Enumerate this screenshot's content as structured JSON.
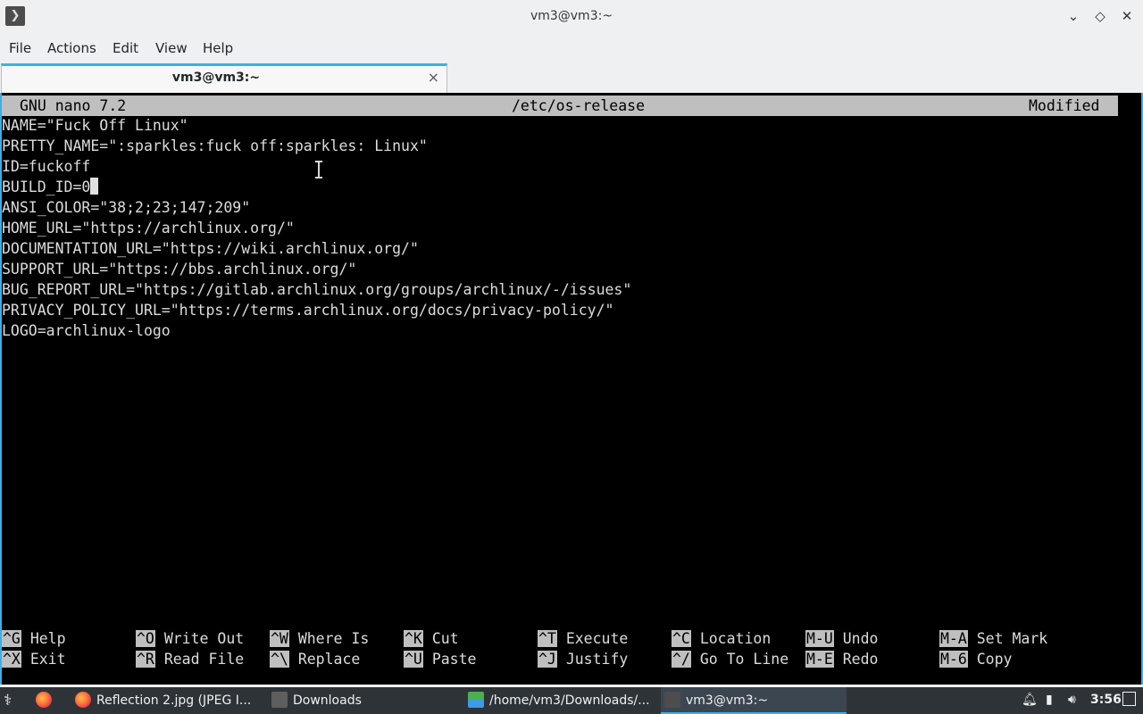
{
  "window": {
    "title": "vm3@vm3:~"
  },
  "menu": [
    "File",
    "Actions",
    "Edit",
    "View",
    "Help"
  ],
  "tab": {
    "label": "vm3@vm3:~",
    "close": "×"
  },
  "nano": {
    "version": "GNU nano 7.2",
    "filename": "/etc/os-release",
    "status": "Modified",
    "lines": [
      "NAME=\"Fuck Off Linux\"",
      "PRETTY_NAME=\":sparkles:fuck off:sparkles: Linux\"",
      "ID=fuckoff",
      "BUILD_ID=0",
      "ANSI_COLOR=\"38;2;23;147;209\"",
      "HOME_URL=\"https://archlinux.org/\"",
      "DOCUMENTATION_URL=\"https://wiki.archlinux.org/\"",
      "SUPPORT_URL=\"https://bbs.archlinux.org/\"",
      "BUG_REPORT_URL=\"https://gitlab.archlinux.org/groups/archlinux/-/issues\"",
      "PRIVACY_POLICY_URL=\"https://terms.archlinux.org/docs/privacy-policy/\"",
      "LOGO=archlinux-logo"
    ],
    "shortcuts_row1": [
      {
        "key": "^G",
        "label": "Help"
      },
      {
        "key": "^O",
        "label": "Write Out"
      },
      {
        "key": "^W",
        "label": "Where Is"
      },
      {
        "key": "^K",
        "label": "Cut"
      },
      {
        "key": "^T",
        "label": "Execute"
      },
      {
        "key": "^C",
        "label": "Location"
      },
      {
        "key": "M-U",
        "label": "Undo"
      },
      {
        "key": "M-A",
        "label": "Set Mark"
      }
    ],
    "shortcuts_row2": [
      {
        "key": "^X",
        "label": "Exit"
      },
      {
        "key": "^R",
        "label": "Read File"
      },
      {
        "key": "^\\",
        "label": "Replace"
      },
      {
        "key": "^U",
        "label": "Paste"
      },
      {
        "key": "^J",
        "label": "Justify"
      },
      {
        "key": "^/",
        "label": "Go To Line"
      },
      {
        "key": "M-E",
        "label": "Redo"
      },
      {
        "key": "M-6",
        "label": "Copy"
      }
    ]
  },
  "taskbar": {
    "tasks": [
      {
        "label": "Reflection 2.jpg (JPEG I...",
        "icon": "firefox-icon"
      },
      {
        "label": "Downloads",
        "icon": "folder-icon"
      },
      {
        "label": "/home/vm3/Downloads/...",
        "icon": "image-viewer-icon"
      },
      {
        "label": "vm3@vm3:~",
        "icon": "terminal-icon",
        "active": true
      }
    ],
    "clock": "3:56"
  }
}
